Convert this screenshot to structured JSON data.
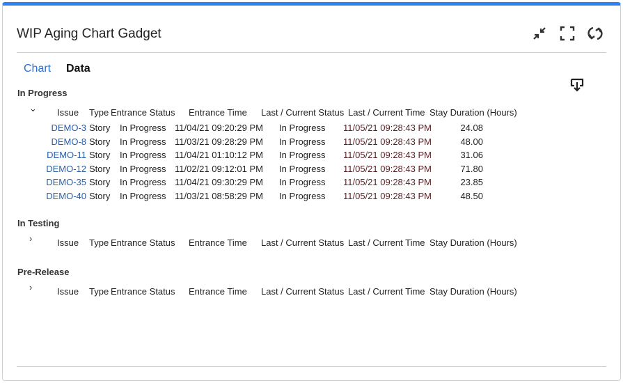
{
  "title": "WIP Aging Chart Gadget",
  "tabs": {
    "chart": "Chart",
    "data": "Data"
  },
  "icons": [
    "minimize-icon",
    "fullscreen-icon",
    "refresh-icon",
    "download-icon"
  ],
  "columns": [
    "Issue",
    "Type",
    "Entrance Status",
    "Entrance Time",
    "Last / Current Status",
    "Last / Current Time",
    "Stay Duration (Hours)"
  ],
  "sections": [
    {
      "name": "In Progress",
      "expanded": true,
      "rows": [
        [
          "DEMO-3",
          "Story",
          "In Progress",
          "11/04/21 09:20:29 PM",
          "In Progress",
          "11/05/21 09:28:43 PM",
          "24.08"
        ],
        [
          "DEMO-8",
          "Story",
          "In Progress",
          "11/03/21 09:28:29 PM",
          "In Progress",
          "11/05/21 09:28:43 PM",
          "48.00"
        ],
        [
          "DEMO-11",
          "Story",
          "In Progress",
          "11/04/21 01:10:12 PM",
          "In Progress",
          "11/05/21 09:28:43 PM",
          "31.06"
        ],
        [
          "DEMO-12",
          "Story",
          "In Progress",
          "11/02/21 09:12:01 PM",
          "In Progress",
          "11/05/21 09:28:43 PM",
          "71.80"
        ],
        [
          "DEMO-35",
          "Story",
          "In Progress",
          "11/04/21 09:30:29 PM",
          "In Progress",
          "11/05/21 09:28:43 PM",
          "23.85"
        ],
        [
          "DEMO-40",
          "Story",
          "In Progress",
          "11/03/21 08:58:29 PM",
          "In Progress",
          "11/05/21 09:28:43 PM",
          "48.50"
        ]
      ]
    },
    {
      "name": "In Testing",
      "expanded": false,
      "rows": []
    },
    {
      "name": "Pre-Release",
      "expanded": false,
      "rows": []
    }
  ]
}
